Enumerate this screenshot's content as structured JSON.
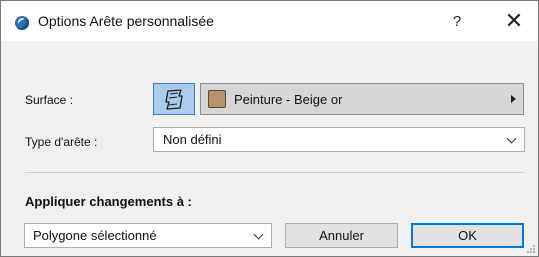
{
  "window": {
    "title": "Options Arête personnalisée",
    "help_label": "?",
    "close_label": "✕"
  },
  "surface": {
    "label": "Surface :",
    "value": "Peinture - Beige or",
    "swatch_color": "#b8926a"
  },
  "edge_type": {
    "label": "Type d'arête :",
    "value": "Non défini"
  },
  "apply": {
    "label": "Appliquer changements à :",
    "value": "Polygone sélectionné"
  },
  "buttons": {
    "cancel": "Annuler",
    "ok": "OK"
  }
}
